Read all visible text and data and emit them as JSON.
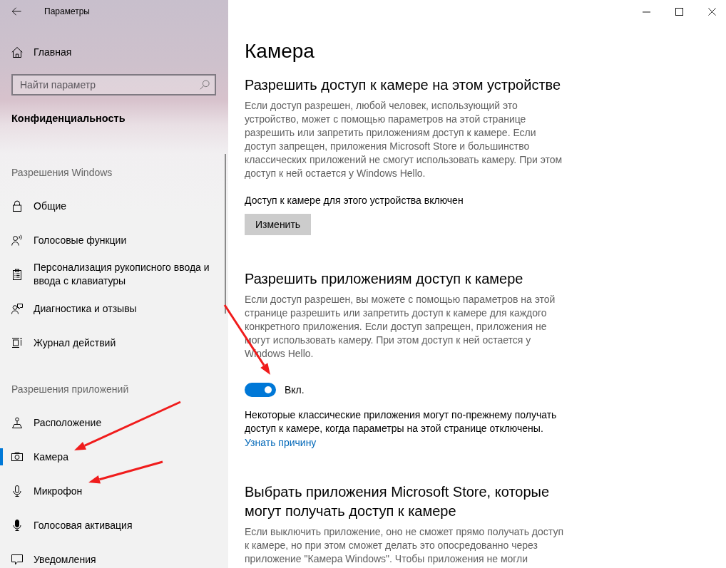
{
  "window": {
    "title": "Параметры",
    "controls": [
      {
        "kind": "minimize"
      },
      {
        "kind": "maximize"
      },
      {
        "kind": "close"
      }
    ]
  },
  "sidebar": {
    "home": {
      "label": "Главная"
    },
    "search": {
      "placeholder": "Найти параметр"
    },
    "section_title": "Конфиденциальность",
    "groups": [
      {
        "heading": "Разрешения Windows",
        "items": [
          {
            "kind": "lock",
            "label": "Общие",
            "selected": false
          },
          {
            "kind": "voice",
            "label": "Голосовые функции",
            "selected": false
          },
          {
            "kind": "handwriting",
            "label": "Персонализация рукописного ввода и ввода с клавиатуры",
            "selected": false
          },
          {
            "kind": "feedback",
            "label": "Диагностика и отзывы",
            "selected": false
          },
          {
            "kind": "history",
            "label": "Журнал действий",
            "selected": false
          }
        ]
      },
      {
        "heading": "Разрешения приложений",
        "items": [
          {
            "kind": "location",
            "label": "Расположение",
            "selected": false
          },
          {
            "kind": "camera",
            "label": "Камера",
            "selected": true
          },
          {
            "kind": "microphone",
            "label": "Микрофон",
            "selected": false
          },
          {
            "kind": "activation",
            "label": "Голосовая активация",
            "selected": false
          },
          {
            "kind": "notifications",
            "label": "Уведомления",
            "selected": false
          }
        ]
      }
    ]
  },
  "page": {
    "title": "Камера",
    "sections": [
      {
        "heading": "Разрешить доступ к камере на этом устройстве",
        "description": "Если доступ разрешен, любой человек, использующий это устройство, может с помощью параметров на этой странице разрешить или запретить приложениям доступ к камере. Если доступ запрещен, приложения Microsoft Store и большинство классических приложений не смогут использовать камеру. При этом доступ к ней остается у Windows Hello.",
        "status": "Доступ к камере для этого устройства включен",
        "button": "Изменить"
      },
      {
        "heading": "Разрешить приложениям доступ к камере",
        "description": "Если доступ разрешен, вы можете с помощью параметров на этой странице разрешить или запретить доступ к камере для каждого конкретного приложения. Если доступ запрещен, приложения не могут использовать камеру. При этом доступ к ней остается у Windows Hello.",
        "toggle": {
          "on": true,
          "label": "Вкл."
        },
        "note": "Некоторые классические приложения могут по-прежнему получать доступ к камере, когда параметры на этой странице отключены.",
        "link": "Узнать причину"
      },
      {
        "heading": "Выбрать приложения Microsoft Store, которые могут получать доступ к камере",
        "description": "Если выключить приложение, оно не сможет прямо получать доступ к камере, но при этом сможет делать это опосредованно через приложение \"Камера Windows\". Чтобы приложения не могли"
      }
    ]
  }
}
